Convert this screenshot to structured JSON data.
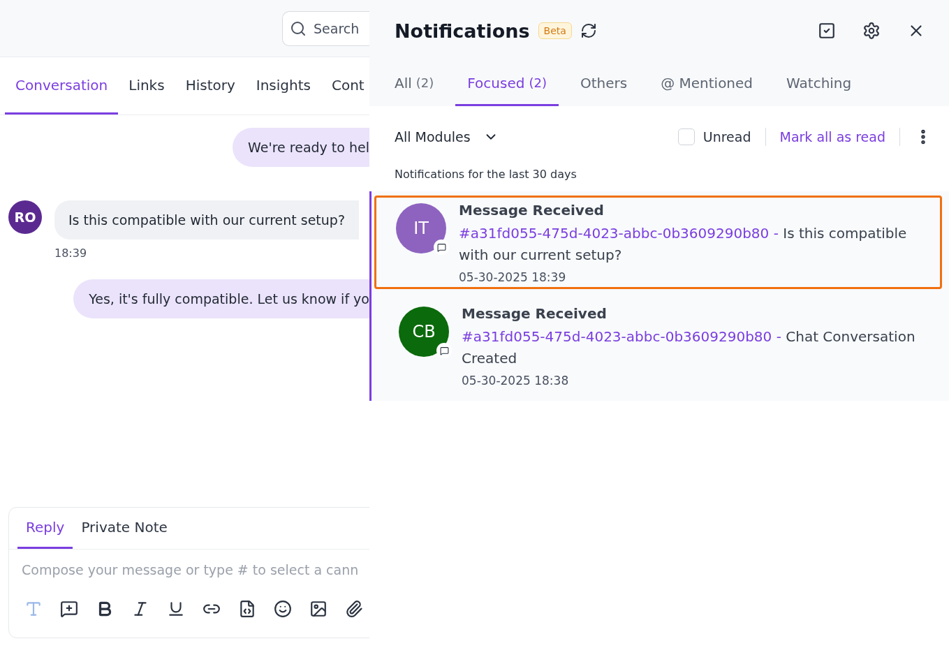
{
  "conversation": {
    "search": {
      "placeholder": "Search"
    },
    "tabs": [
      {
        "label": "Conversation",
        "selected": true
      },
      {
        "label": "Links",
        "selected": false
      },
      {
        "label": "History",
        "selected": false
      },
      {
        "label": "Insights",
        "selected": false
      },
      {
        "label": "Cont",
        "selected": false
      }
    ],
    "messages": [
      {
        "kind": "outgoing",
        "text": "We're ready to hel"
      },
      {
        "kind": "incoming",
        "avatar": "RO",
        "color": "#5b2a91",
        "text": "Is this compatible with our current setup?",
        "time": "18:39"
      },
      {
        "kind": "outgoing",
        "text": "Yes, it's fully compatible. Let us know if yo"
      }
    ],
    "composer": {
      "tabs": [
        {
          "label": "Reply",
          "selected": true
        },
        {
          "label": "Private Note",
          "selected": false
        }
      ],
      "placeholder": "Compose your message or type # to select a cann"
    }
  },
  "notifications": {
    "title": "Notifications",
    "badge": "Beta",
    "tabs": [
      {
        "label": "All",
        "count": "(2)",
        "selected": false
      },
      {
        "label": "Focused",
        "count": "(2)",
        "selected": true
      },
      {
        "label": "Others",
        "selected": false
      },
      {
        "label": "@ Mentioned",
        "selected": false
      },
      {
        "label": "Watching",
        "selected": false
      }
    ],
    "filter": {
      "module": "All Modules",
      "unread_label": "Unread",
      "unread_checked": false,
      "mark_all": "Mark all as read"
    },
    "caption": "Notifications for the last 30 days",
    "items": [
      {
        "avatar": "IT",
        "color": "#8e63bf",
        "title": "Message Received",
        "ref": "#a31fd055-475d-4023-abbc-0b3609290b80",
        "separator": "-",
        "text": "Is this compatible with our current setup?",
        "time": "05-30-2025 18:39",
        "unread": true,
        "highlighted": true
      },
      {
        "avatar": "CB",
        "color": "#0b6a0b",
        "title": "Message Received",
        "ref": "#a31fd055-475d-4023-abbc-0b3609290b80",
        "separator": "-",
        "text": "Chat Conversation Created",
        "time": "05-30-2025 18:38",
        "unread": true,
        "highlighted": false
      }
    ]
  }
}
